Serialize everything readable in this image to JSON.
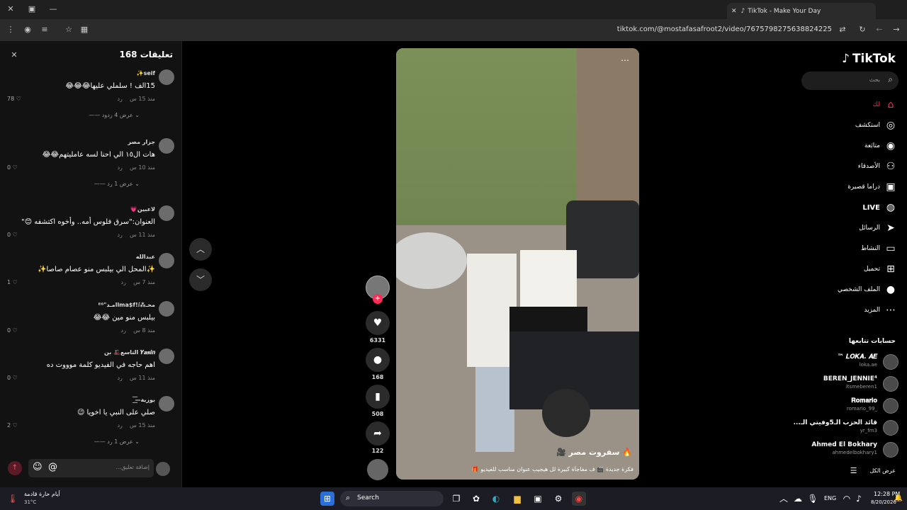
{
  "browser": {
    "tab_title": "TikTok - Make Your Day",
    "url": "tiktok.com/@mostafasafroot2/video/7675798275638824225"
  },
  "comments": {
    "header": "تعليقات 168",
    "items": [
      {
        "name": "seif✨",
        "text": "15الف ! سلملي عليها😂😂😂",
        "time": "منذ 15 س",
        "reply": "رد",
        "likes": "78",
        "replies": "عرض 4 ردود"
      },
      {
        "name": "جزار مصر",
        "text": "هات ال١٥ الي احنا لسه عامليتهم😂😂",
        "time": "منذ 10 س",
        "reply": "رد",
        "likes": "0",
        "replies": "عرض 1 رد"
      },
      {
        "name": "لاعبين💗",
        "text": "العنوان:\"سرق فلوس أمه.. وأخوه اكتشفه 😊\"",
        "time": "منذ 11 س",
        "reply": "رد",
        "likes": "0",
        "replies": ""
      },
      {
        "name": "عبدالله",
        "text": "✨المحل الي بيلبس منو عصام صاصا✨",
        "time": "منذ 7 س",
        "reply": "رد",
        "likes": "1",
        "replies": ""
      },
      {
        "name": "محـ⁂lma$f!ⅈامـد\"ᴱᴳ",
        "text": "بيلبس منو مين 😂😂",
        "time": "منذ 8 س",
        "reply": "رد",
        "likes": "0",
        "replies": ""
      },
      {
        "name": "𝒀𝒂𝒔𝒊𝒏 التاسع🎩 بن",
        "text": "اهم حاجه في الفيديو كلمة موووت ده",
        "time": "منذ 11 س",
        "reply": "رد",
        "likes": "0",
        "replies": ""
      },
      {
        "name": "بوزية—͟͞",
        "text": "صلي على النبي يا اخويا 😉",
        "time": "منذ 15 س",
        "reply": "رد",
        "likes": "2",
        "replies": "عرض 1 رد"
      }
    ],
    "input_placeholder": "إضافة تعليق..."
  },
  "video": {
    "title": "🔥 سفروت مصر 🎥",
    "caption": "فكرة جديدة 🎬 ف مفاجأة كبيرة لل هيجيب عنوان مناسب للفيديو 🎁"
  },
  "actions": {
    "likes": "6331",
    "comments": "168",
    "saves": "508",
    "shares": "122"
  },
  "sidebar": {
    "logo": "TikTok",
    "search_placeholder": "بحث",
    "nav": [
      {
        "label": "لك",
        "icon": "home-icon"
      },
      {
        "label": "استكشف",
        "icon": "compass-icon"
      },
      {
        "label": "متابَعة",
        "icon": "following-icon"
      },
      {
        "label": "الأصدقاء",
        "icon": "friends-icon"
      },
      {
        "label": "دراما قصيرة",
        "icon": "drama-icon"
      },
      {
        "label": "LIVE",
        "icon": "live-icon"
      },
      {
        "label": "الرسائل",
        "icon": "messages-icon"
      },
      {
        "label": "النشاط",
        "icon": "activity-icon"
      },
      {
        "label": "تحميل",
        "icon": "upload-icon"
      },
      {
        "label": "الملف الشخصي",
        "icon": "profile-icon"
      },
      {
        "label": "المزيد",
        "icon": "more-icon"
      }
    ],
    "following_header": "حسابات تتابعها",
    "following": [
      {
        "name": "𝑳𝑶𝑲𝑨. 𝑨𝑬 ™",
        "handle": "loka.ae"
      },
      {
        "name": "BEREN_JENNIE⁴",
        "handle": "itsmeberen1"
      },
      {
        "name": "𝐑𝐨𝐦𝐚𝐫𝐢𝐨",
        "handle": "romario_99_"
      },
      {
        "name": "قائد الحزب الـ5وفيتي الـ...",
        "handle": "yr_fm3"
      },
      {
        "name": "Ahmed El Bokhary",
        "handle": "ahmedelbokhary1"
      }
    ],
    "see_all": "عرض الكل"
  },
  "taskbar": {
    "weather": "أيام حارة قادمة",
    "temp": "31°C",
    "search": "Search",
    "lang": "ENG",
    "time": "12:28 PM",
    "date": "8/20/2026"
  },
  "colors": {
    "accent": "#fe2c55",
    "bg": "#000000",
    "panel": "#121212"
  }
}
